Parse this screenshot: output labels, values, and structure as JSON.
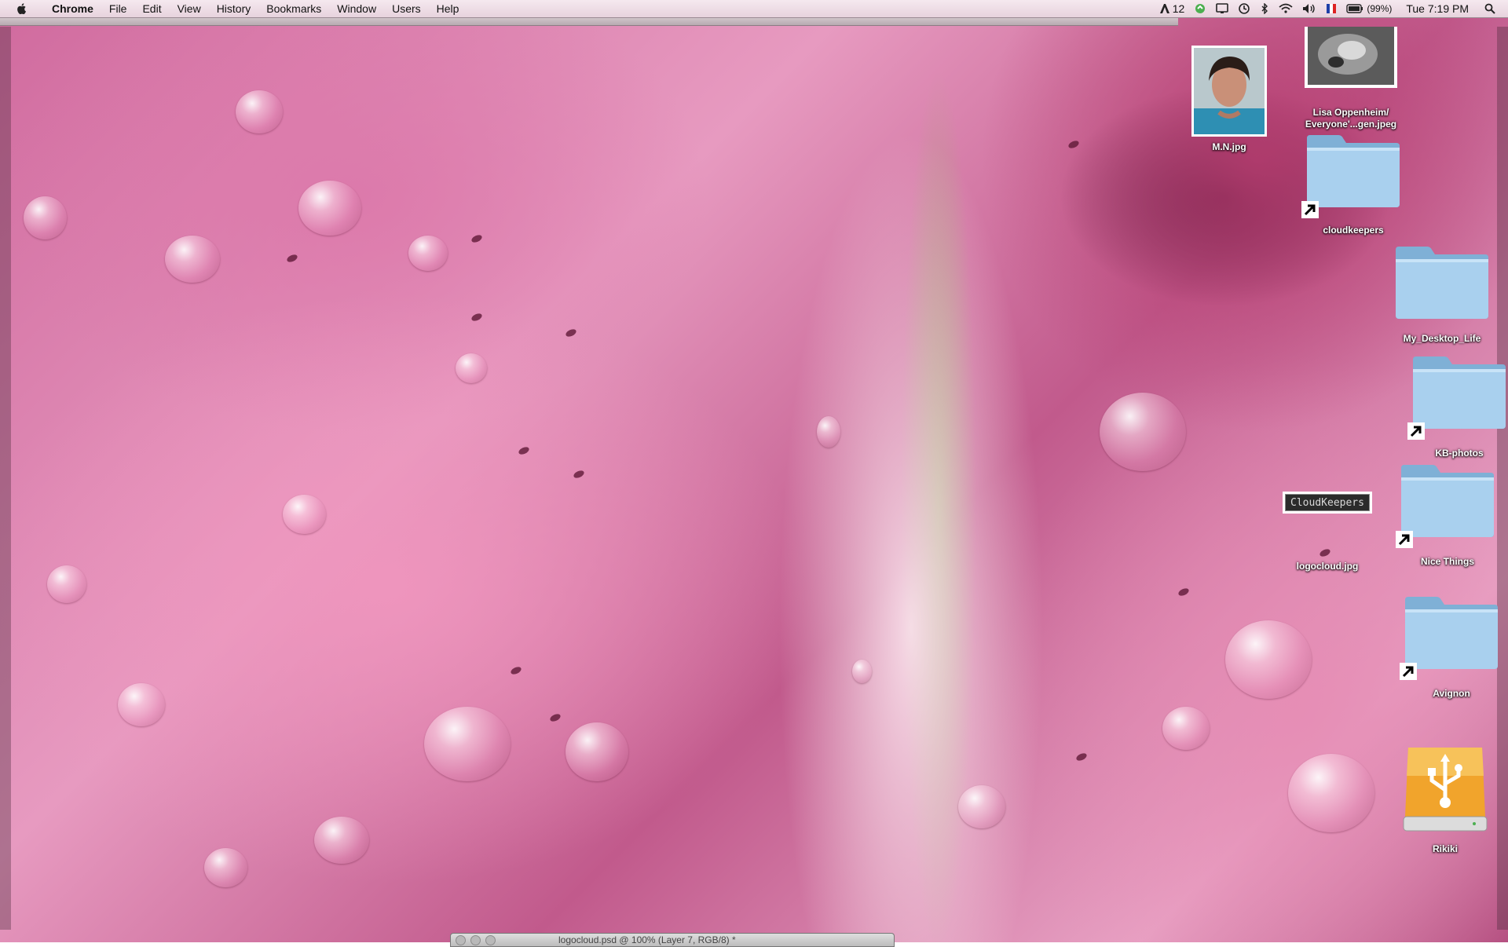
{
  "menubar": {
    "app_name": "Chrome",
    "items": [
      "File",
      "Edit",
      "View",
      "History",
      "Bookmarks",
      "Window",
      "Users",
      "Help"
    ],
    "status": {
      "adobe_count": "12",
      "battery": "(99%)",
      "clock": "Tue 7:19 PM"
    }
  },
  "desktop": {
    "icons": [
      {
        "label_lines": [
          "M.N.jpg"
        ],
        "kind": "photo-portrait"
      },
      {
        "label_lines": [
          "Lisa Oppenheim/",
          "Everyone'...gen.jpeg"
        ],
        "kind": "photo-bw"
      },
      {
        "label_lines": [
          "cloudkeepers"
        ],
        "kind": "folder-alias"
      },
      {
        "label_lines": [
          "My_Desktop_Life"
        ],
        "kind": "folder"
      },
      {
        "label_lines": [
          "KB-photos"
        ],
        "kind": "folder-alias"
      },
      {
        "label_lines": [
          "logocloud.jpg"
        ],
        "kind": "image-logo",
        "logo_text": "CloudKeepers"
      },
      {
        "label_lines": [
          "Nice Things"
        ],
        "kind": "folder-alias"
      },
      {
        "label_lines": [
          "Avignon"
        ],
        "kind": "folder-alias"
      },
      {
        "label_lines": [
          "Rikiki"
        ],
        "kind": "usb-drive"
      }
    ]
  },
  "bottom_window": {
    "title": "logocloud.psd @ 100% (Layer 7, RGB/8) *"
  },
  "colors": {
    "folder_blue": "#9cc7e6",
    "usb_orange": "#f1a42c"
  }
}
